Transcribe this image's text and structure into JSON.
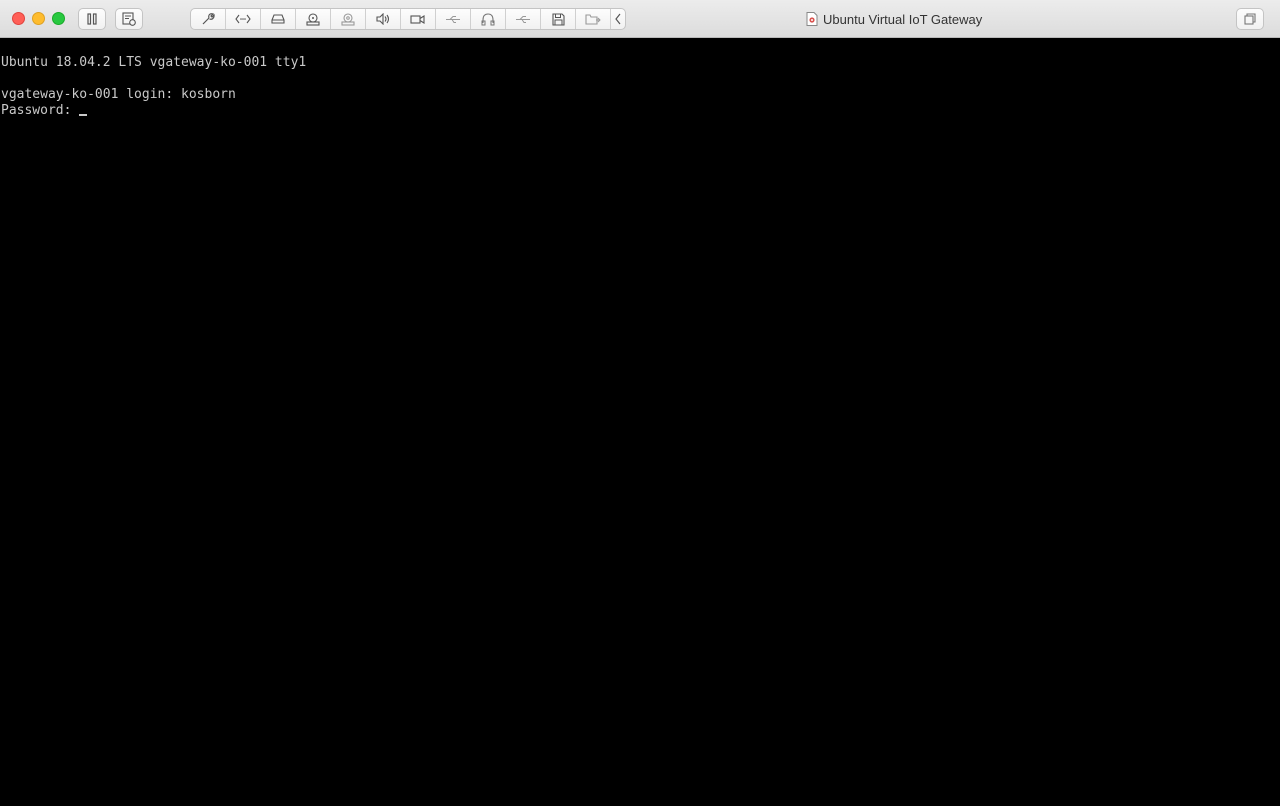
{
  "window": {
    "title": "Ubuntu Virtual IoT Gateway"
  },
  "toolbar": {
    "buttons": [
      {
        "icon": "pause-icon"
      },
      {
        "icon": "snapshot-icon"
      }
    ],
    "devices": [
      {
        "icon": "wrench-icon"
      },
      {
        "icon": "network-icon"
      },
      {
        "icon": "hard-disk-icon"
      },
      {
        "icon": "optical-drive-icon"
      },
      {
        "icon": "camera-icon"
      },
      {
        "icon": "speaker-icon"
      },
      {
        "icon": "video-camera-icon"
      },
      {
        "icon": "usb-icon"
      },
      {
        "icon": "headset-icon"
      },
      {
        "icon": "usb-icon"
      },
      {
        "icon": "floppy-disk-icon"
      },
      {
        "icon": "shared-folder-icon"
      },
      {
        "icon": "chevron-left-icon"
      }
    ]
  },
  "console": {
    "banner": "Ubuntu 18.04.2 LTS vgateway-ko-001 tty1",
    "login_line": "vgateway-ko-001 login: kosborn",
    "password_prompt": "Password: "
  },
  "colors": {
    "console_bg": "#000000",
    "console_fg": "#c9c9c9"
  }
}
